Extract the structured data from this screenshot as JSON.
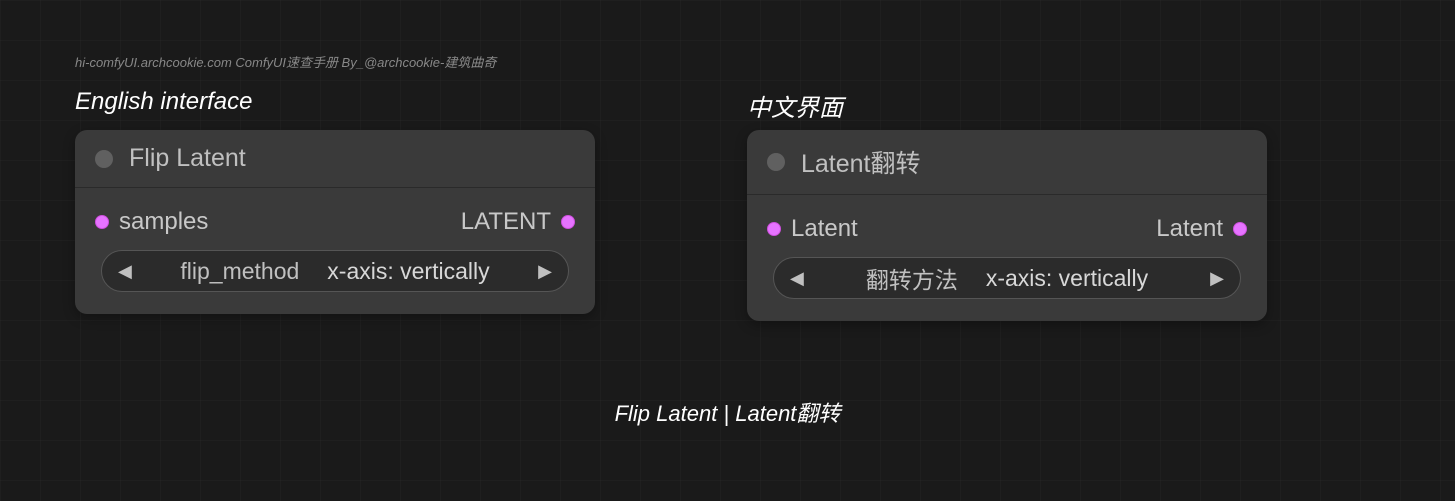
{
  "watermark": "hi-comfyUI.archcookie.com ComfyUI速查手册 By_@archcookie-建筑曲奇",
  "section_labels": {
    "en": "English interface",
    "zh": "中文界面"
  },
  "nodes": {
    "en": {
      "title": "Flip Latent",
      "input_label": "samples",
      "output_label": "LATENT",
      "selector": {
        "key": "flip_method",
        "value": "x-axis: vertically"
      }
    },
    "zh": {
      "title": "Latent翻转",
      "input_label": "Latent",
      "output_label": "Latent",
      "selector": {
        "key": "翻转方法",
        "value": "x-axis: vertically"
      }
    }
  },
  "bottom_caption": "Flip Latent | Latent翻转",
  "glyphs": {
    "arrow_left": "◀",
    "arrow_right": "▶"
  }
}
